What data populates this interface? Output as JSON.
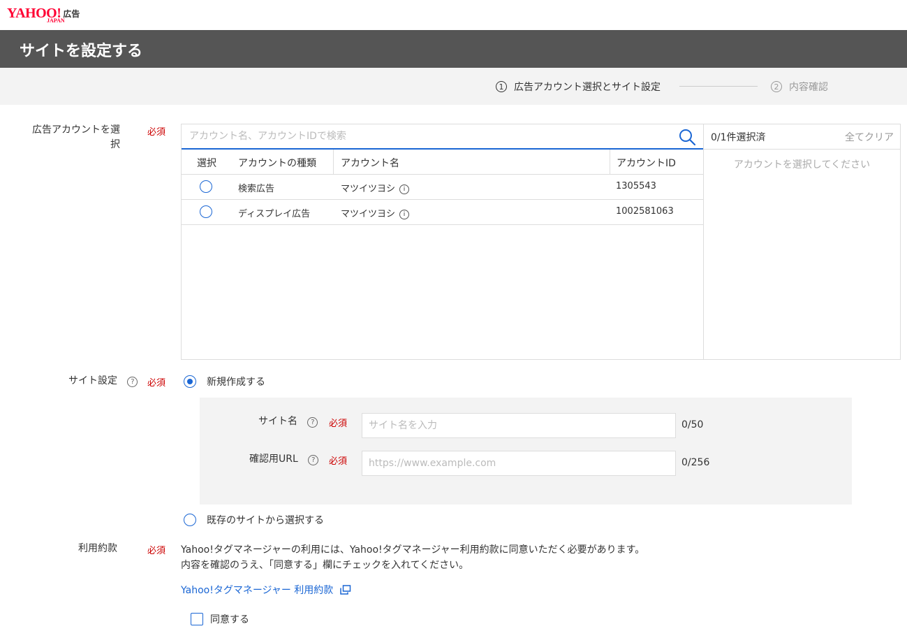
{
  "header": {
    "brand_name": "YAHOO!",
    "brand_sub": "JAPAN",
    "brand_suffix": "広告"
  },
  "page_title": "サイトを設定する",
  "steps": [
    {
      "num": "1",
      "label": "広告アカウント選択とサイト設定",
      "active": true
    },
    {
      "num": "2",
      "label": "内容確認",
      "active": false
    }
  ],
  "account_section": {
    "label": "広告アカウントを選択",
    "required": "必須",
    "search_placeholder": "アカウント名、アカウントIDで検索",
    "columns": [
      "選択",
      "アカウントの種類",
      "アカウント名",
      "アカウントID"
    ],
    "rows": [
      {
        "type": "検索広告",
        "name": "マツイツヨシ",
        "id": "1305543"
      },
      {
        "type": "ディスプレイ広告",
        "name": "マツイツヨシ",
        "id": "1002581063"
      }
    ],
    "selected_count": "0/1件選択済",
    "clear_all": "全てクリア",
    "empty_message": "アカウントを選択してください"
  },
  "site_section": {
    "label": "サイト設定",
    "required": "必須",
    "option_new": "新規作成する",
    "option_existing": "既存のサイトから選択する",
    "site_name": {
      "label": "サイト名",
      "required": "必須",
      "placeholder": "サイト名を入力",
      "counter": "0/50"
    },
    "confirm_url": {
      "label": "確認用URL",
      "required": "必須",
      "placeholder": "https://www.example.com",
      "counter": "0/256"
    }
  },
  "terms_section": {
    "label": "利用約款",
    "required": "必須",
    "text_line1": "Yahoo!タグマネージャーの利用には、Yahoo!タグマネージャー利用約款に同意いただく必要があります。",
    "text_line2": "内容を確認のうえ、「同意する」欄にチェックを入れてください。",
    "link": "Yahoo!タグマネージャー 利用約款",
    "agree_label": "同意する"
  },
  "colors": {
    "accent": "#1a66d4",
    "required": "#cc0000",
    "title_bar": "#555555",
    "brand": "#ff0033"
  }
}
